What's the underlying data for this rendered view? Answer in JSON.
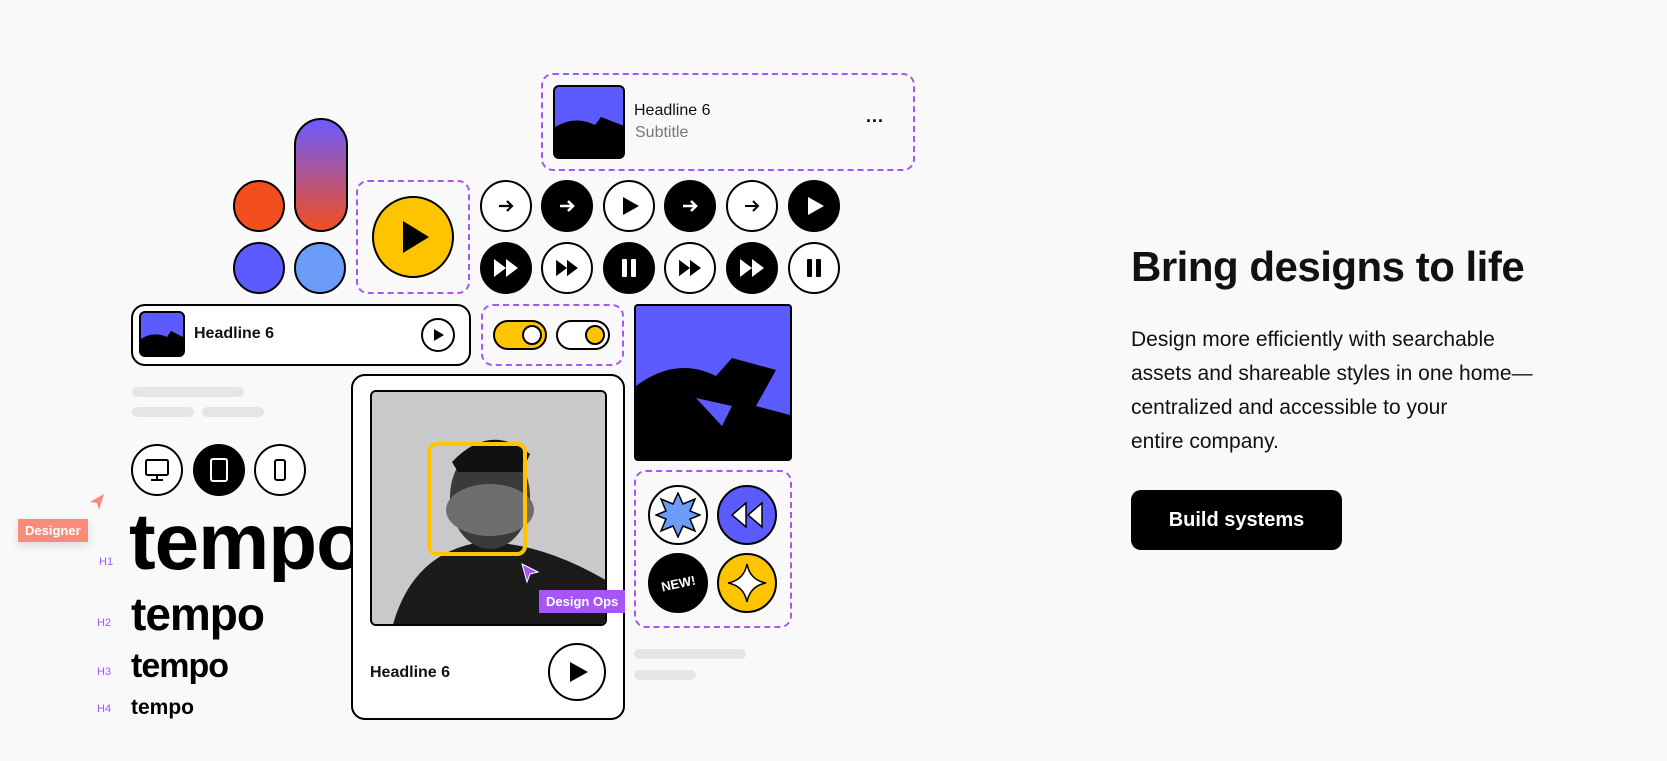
{
  "media_card_top": {
    "headline": "Headline 6",
    "subtitle": "Subtitle",
    "more_label": "..."
  },
  "media_row": {
    "headline": "Headline 6"
  },
  "big_card": {
    "headline": "Headline 6"
  },
  "typography": {
    "samples": [
      {
        "level": "H1",
        "text": "tempo"
      },
      {
        "level": "H2",
        "text": "tempo"
      },
      {
        "level": "H3",
        "text": "tempo"
      },
      {
        "level": "H4",
        "text": "tempo"
      }
    ]
  },
  "tags": {
    "designer": "Designer",
    "design_ops": "Design Ops",
    "new_badge": "NEW!"
  },
  "hero": {
    "title": "Bring designs to life",
    "description_lines": [
      "Design more efficiently with searchable",
      "assets and shareable styles in one home—",
      "centralized and accessible to your",
      "entire company."
    ],
    "cta_label": "Build systems"
  },
  "colors": {
    "purple": "#a855f7",
    "blue": "#5b5bff",
    "light_blue": "#6b9cf8",
    "orange": "#f24e1e",
    "yellow": "#ffc400",
    "salmon": "#f98b7b",
    "black": "#000000"
  },
  "icons": {
    "button_grid": [
      "arrow-right-icon",
      "arrow-right-icon",
      "play-icon",
      "arrow-right-icon",
      "arrow-right-icon",
      "play-icon",
      "fast-forward-icon",
      "fast-forward-icon",
      "pause-icon",
      "fast-forward-icon",
      "fast-forward-icon",
      "pause-icon"
    ],
    "devices": [
      "desktop-icon",
      "tablet-icon",
      "phone-icon"
    ],
    "badges": [
      "starburst-icon",
      "rewind-icon",
      "new-badge",
      "sparkle-icon"
    ]
  }
}
